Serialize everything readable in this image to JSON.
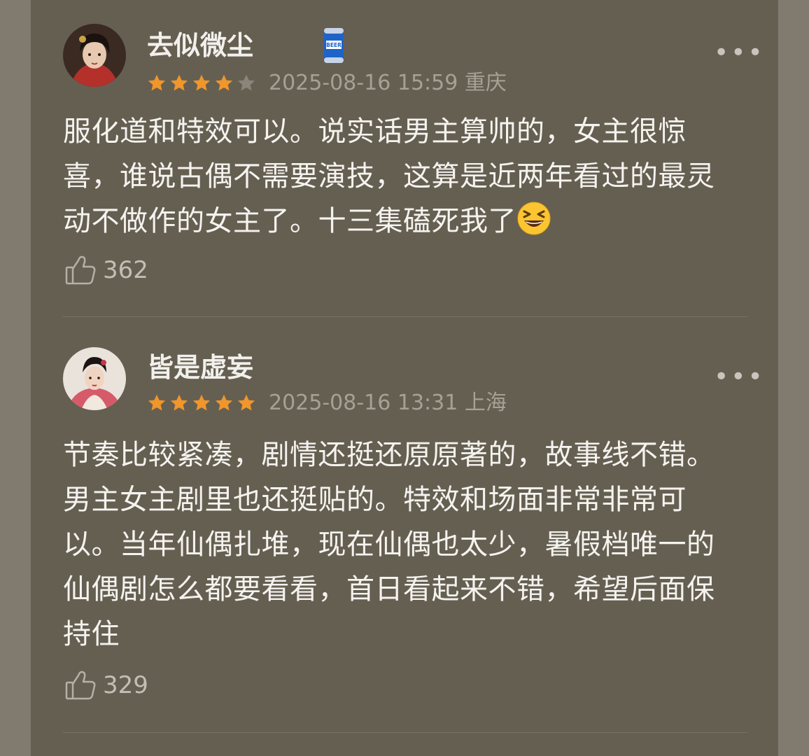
{
  "reviews": [
    {
      "username": "去似微尘",
      "rating": 4,
      "date": "2025-08-16 15:59",
      "location": "重庆",
      "text": "服化道和特效可以。说实话男主算帅的，女主很惊喜，谁说古偶不需要演技，这算是近两年看过的最灵动不做作的女主了。十三集磕死我了",
      "emoji": "grinning-squinting-face-emoji",
      "likes": "362",
      "badge_icon": "beer-can-icon",
      "badge_text": "BEER"
    },
    {
      "username": "皆是虚妄",
      "rating": 5,
      "date": "2025-08-16 13:31",
      "location": "上海",
      "text": "节奏比较紧凑，剧情还挺还原原著的，故事线不错。男主女主剧里也还挺贴的。特效和场面非常非常可以。当年仙偶扎堆，现在仙偶也太少，暑假档唯一的仙偶剧怎么都要看看，首日看起来不错，希望后面保持住",
      "likes": "329"
    }
  ],
  "colors": {
    "star_filled": "#f0962a",
    "star_empty": "#8a847a",
    "panel_bg": "#655f52",
    "outer_bg": "#817a6e"
  }
}
